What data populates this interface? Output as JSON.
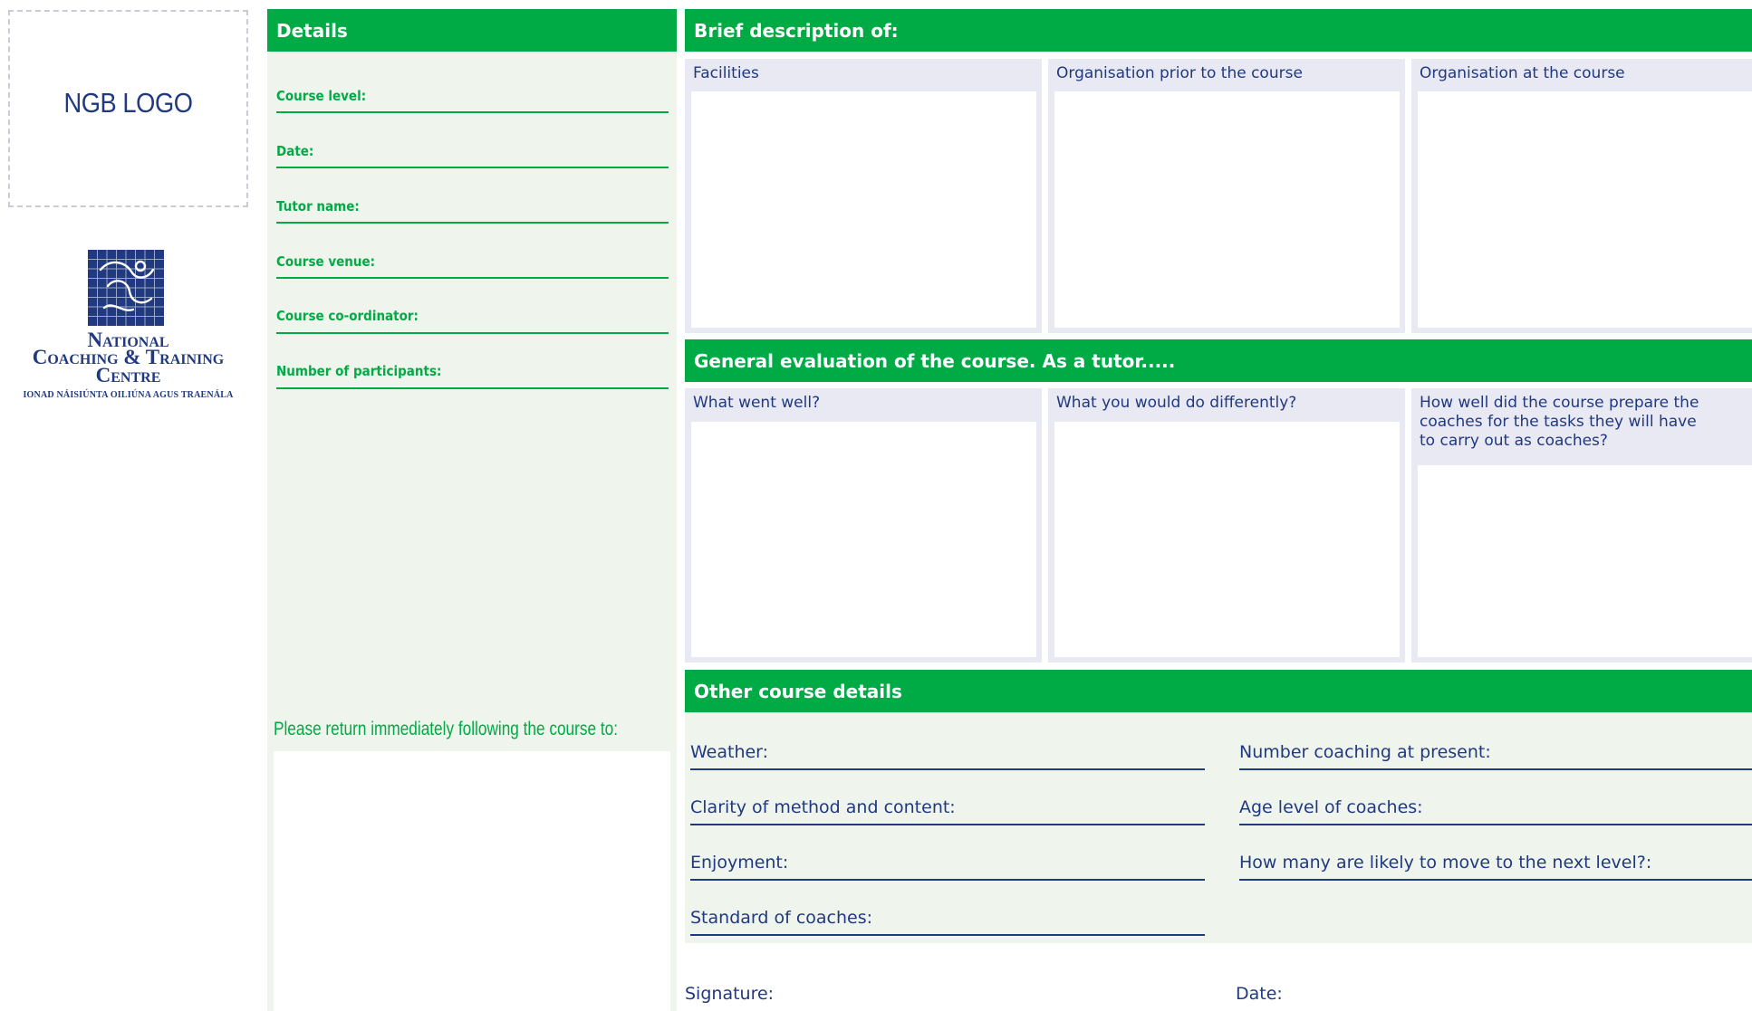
{
  "logo": {
    "ngb_placeholder": "NGB LOGO"
  },
  "nctc": {
    "line1": "National",
    "line2": "Coaching & Training",
    "line3": "Centre",
    "line4": "IONAD NÁISIÚNTA OILIÚNA AGUS TRAENÁLA",
    "brand_color": "#20397f"
  },
  "details": {
    "header": "Details",
    "fields": [
      "Course level:",
      "Date:",
      "Tutor name:",
      "Course venue:",
      "Course co-ordinator:",
      "Number of participants:"
    ],
    "return_note": "Please return immediately following the course to:"
  },
  "brief": {
    "header": "Brief description of:",
    "panels": [
      "Facilities",
      "Organisation prior to the course",
      "Organisation at the course"
    ]
  },
  "evaluation": {
    "header": "General evaluation of the course. As a tutor.....",
    "panels": [
      "What went well?",
      "What you would do differently?",
      "How well did the course prepare the coaches for the tasks they will have to carry out as coaches?"
    ]
  },
  "other": {
    "header": "Other course details",
    "left_fields": [
      "Weather:",
      "Clarity of method and content:",
      "Enjoyment:",
      "Standard of coaches:"
    ],
    "right_fields": [
      "Number coaching at present:",
      "Age level of coaches:",
      "How many are likely to move to the next level?:"
    ]
  },
  "footer": {
    "signature": "Signature:",
    "date": "Date:"
  },
  "colors": {
    "green": "#00ab46",
    "navy": "#20397f",
    "panel_grey": "#e9e9f3",
    "panel_green": "#eff5ed"
  }
}
